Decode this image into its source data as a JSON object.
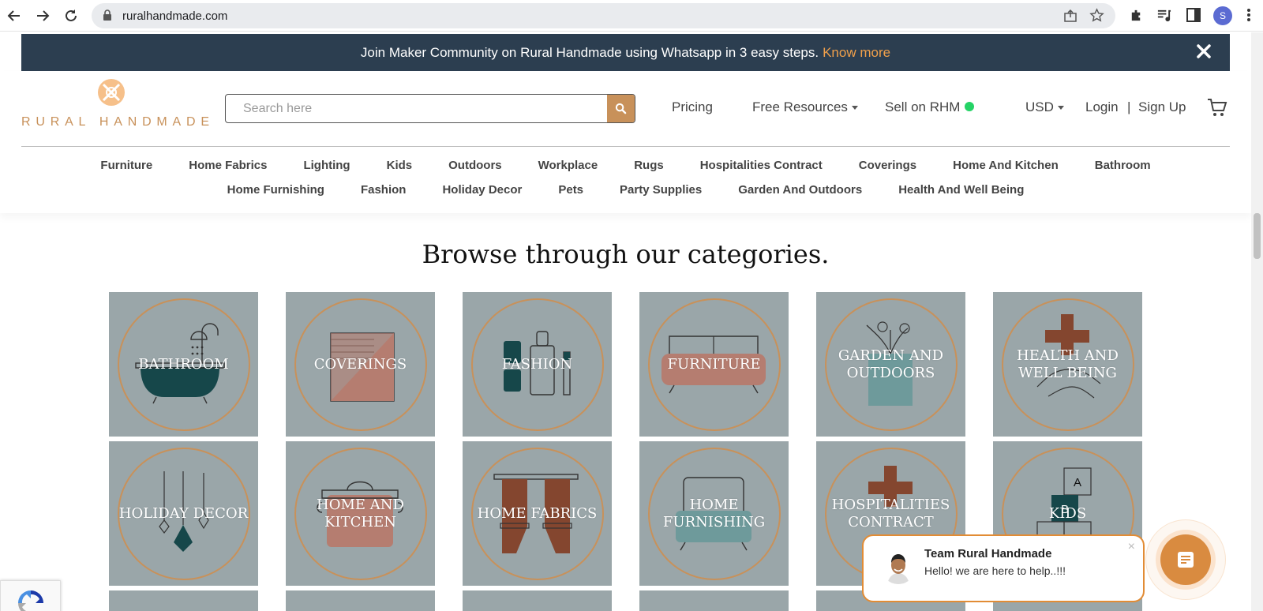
{
  "browser": {
    "url": "ruralhandmade.com",
    "profile_initial": "S"
  },
  "banner": {
    "text": "Join Maker Community on Rural Handmade using Whatsapp in 3 easy steps.",
    "link": "Know more"
  },
  "header": {
    "logo_text": "RURAL HANDMADE",
    "search_placeholder": "Search here",
    "pricing": "Pricing",
    "free_resources": "Free Resources",
    "sell": "Sell on RHM",
    "currency": "USD",
    "login": "Login",
    "separator": "|",
    "signup": "Sign Up"
  },
  "categories_nav": {
    "row1": [
      "Furniture",
      "Home Fabrics",
      "Lighting",
      "Kids",
      "Outdoors",
      "Workplace",
      "Rugs",
      "Hospitalities Contract",
      "Coverings",
      "Home And Kitchen",
      "Bathroom"
    ],
    "row2": [
      "Home Furnishing",
      "Fashion",
      "Holiday Decor",
      "Pets",
      "Party Supplies",
      "Garden And Outdoors",
      "Health And Well Being"
    ]
  },
  "main": {
    "heading": "Browse through our categories.",
    "tiles_row1": [
      {
        "label": "BATHROOM",
        "icon": "bathtub-icon"
      },
      {
        "label": "COVERINGS",
        "icon": "coverings-icon"
      },
      {
        "label": "FASHION",
        "icon": "fashion-icon"
      },
      {
        "label": "FURNITURE",
        "icon": "sofa-icon"
      },
      {
        "label": "GARDEN AND OUTDOORS",
        "icon": "plant-icon"
      },
      {
        "label": "HEALTH AND WELL BEING",
        "icon": "health-icon"
      }
    ],
    "tiles_row2": [
      {
        "label": "HOLIDAY DECOR",
        "icon": "ornament-icon"
      },
      {
        "label": "HOME AND KITCHEN",
        "icon": "pot-icon"
      },
      {
        "label": "HOME FABRICS",
        "icon": "curtain-icon"
      },
      {
        "label": "HOME FURNISHING",
        "icon": "armchair-icon"
      },
      {
        "label": "HOSPITALITIES CONTRACT",
        "icon": "hospital-cross-icon"
      },
      {
        "label": "KIDS",
        "icon": "blocks-icon"
      }
    ],
    "block_letters": [
      "A",
      "B"
    ]
  },
  "chat": {
    "title": "Team Rural Handmade",
    "message": "Hello! we are here to help..!!!",
    "close": "×"
  },
  "colors": {
    "accent": "#c8915a",
    "banner_bg": "#2c3e50",
    "tile_bg": "#9aa6a9",
    "chat_accent": "#e28c35"
  }
}
